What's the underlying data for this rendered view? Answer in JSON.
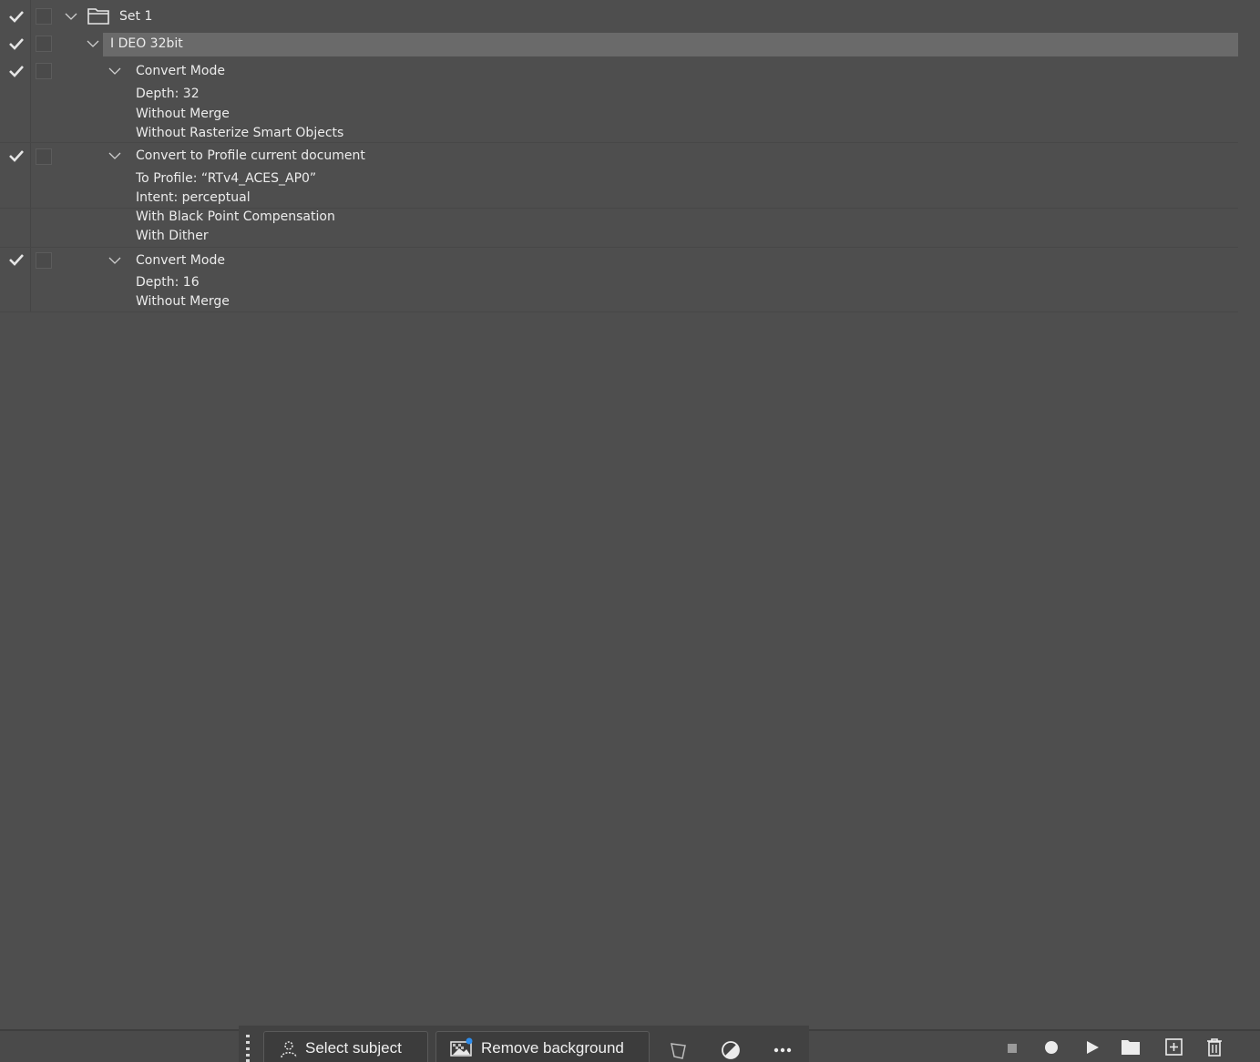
{
  "actions_panel": {
    "set": {
      "label": "Set 1",
      "checked": true
    },
    "action": {
      "label": "I DEO 32bit",
      "checked": true
    },
    "steps": [
      {
        "title": "Convert Mode",
        "checked": true,
        "details": [
          "Depth: 32",
          "Without Merge",
          "Without Rasterize Smart Objects"
        ]
      },
      {
        "title": "Convert to Profile current document",
        "checked": true,
        "details": [
          "To Profile:  “RTv4_ACES_AP0”",
          "Intent: perceptual",
          "With Black Point Compensation",
          "With Dither"
        ]
      },
      {
        "title": "Convert Mode",
        "checked": true,
        "details": [
          "Depth: 16",
          "Without Merge"
        ]
      }
    ]
  },
  "contextual_taskbar": {
    "select_subject_label": "Select subject",
    "remove_background_label": "Remove background"
  },
  "panel_footer": {
    "buttons": [
      "stop-icon",
      "record-icon",
      "play-icon",
      "new-set-icon",
      "new-action-icon",
      "delete-icon"
    ]
  },
  "colors": {
    "panel_bg": "#4e4e4e",
    "selected_row": "#6a6a6a",
    "text": "#ececec",
    "accent_dot": "#2d8ceb"
  }
}
